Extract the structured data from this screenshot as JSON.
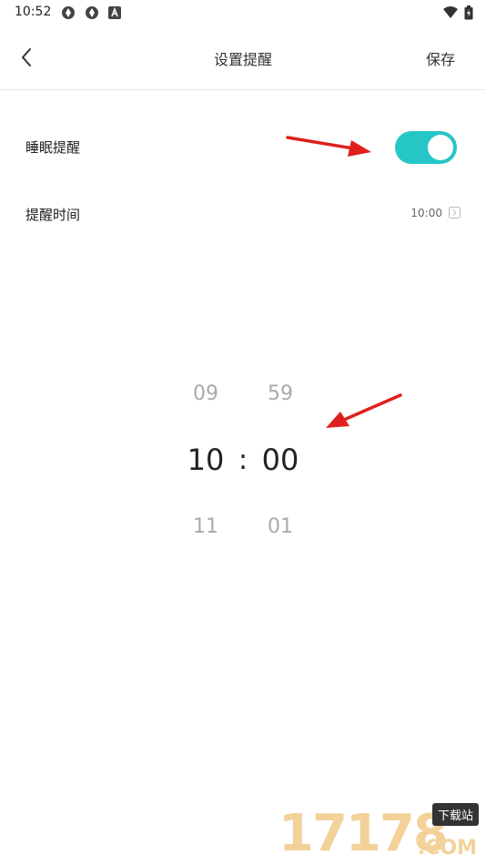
{
  "status_bar": {
    "time": "10:52",
    "left_icons": [
      "aperture-icon",
      "aperture-icon",
      "android-a-icon"
    ],
    "right_icons": [
      "wifi-icon",
      "battery-charging-icon"
    ]
  },
  "header": {
    "back_icon": "chevron-left-icon",
    "title": "设置提醒",
    "save_label": "保存"
  },
  "settings": {
    "sleep_reminder": {
      "label": "睡眠提醒",
      "enabled": true
    },
    "reminder_time": {
      "label": "提醒时间",
      "value": "10:00"
    }
  },
  "picker": {
    "hours": {
      "previous": "09",
      "selected": "10",
      "next": "11"
    },
    "separator": ":",
    "minutes": {
      "previous": "59",
      "selected": "00",
      "next": "01"
    }
  },
  "watermark": {
    "digits": "17178",
    "badge": "下载站",
    "suffix": ".COM"
  },
  "colors": {
    "toggle_on": "#26c6c6",
    "annotation_arrow": "#e0201c",
    "watermark": "#f3d29a"
  }
}
